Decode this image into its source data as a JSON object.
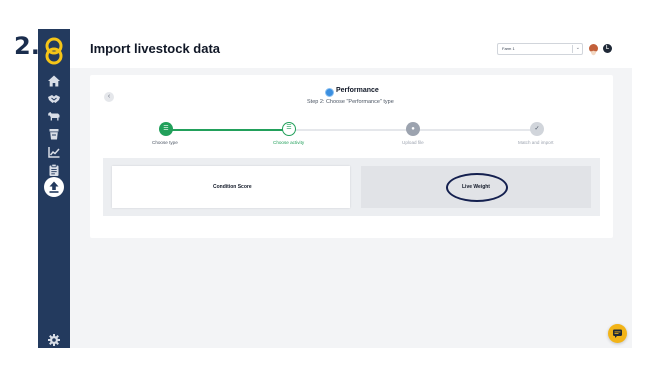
{
  "annotation": {
    "step_number": "2."
  },
  "header": {
    "title": "Import livestock data",
    "farm_select": {
      "value": "Farm 1"
    },
    "user_initial": "L"
  },
  "sidebar": {
    "items": [
      {
        "icon": "home-icon"
      },
      {
        "icon": "handshake-icon"
      },
      {
        "icon": "cow-icon"
      },
      {
        "icon": "feed-bin-icon"
      },
      {
        "icon": "chart-icon"
      },
      {
        "icon": "clipboard-icon"
      },
      {
        "icon": "upload-icon",
        "active": true
      }
    ],
    "footer_icon": "gear-icon"
  },
  "import_card": {
    "type_label": "Performance",
    "subtitle": "Step 2: Choose \"Performance\" type",
    "steps": [
      {
        "label": "Choose type",
        "state": "complete"
      },
      {
        "label": "Choose activity",
        "state": "current"
      },
      {
        "label": "Upload file",
        "state": "pending"
      },
      {
        "label": "Match and import",
        "state": "pending"
      }
    ],
    "options": [
      {
        "label": "Condition Score"
      },
      {
        "label": "Live Weight",
        "highlighted": true
      }
    ]
  },
  "colors": {
    "sidebar": "#233a5e",
    "accent_green": "#22a05b",
    "performance_blue": "#3b8fe0",
    "chat_button": "#f2b418",
    "annotation_circle": "#14204f"
  }
}
